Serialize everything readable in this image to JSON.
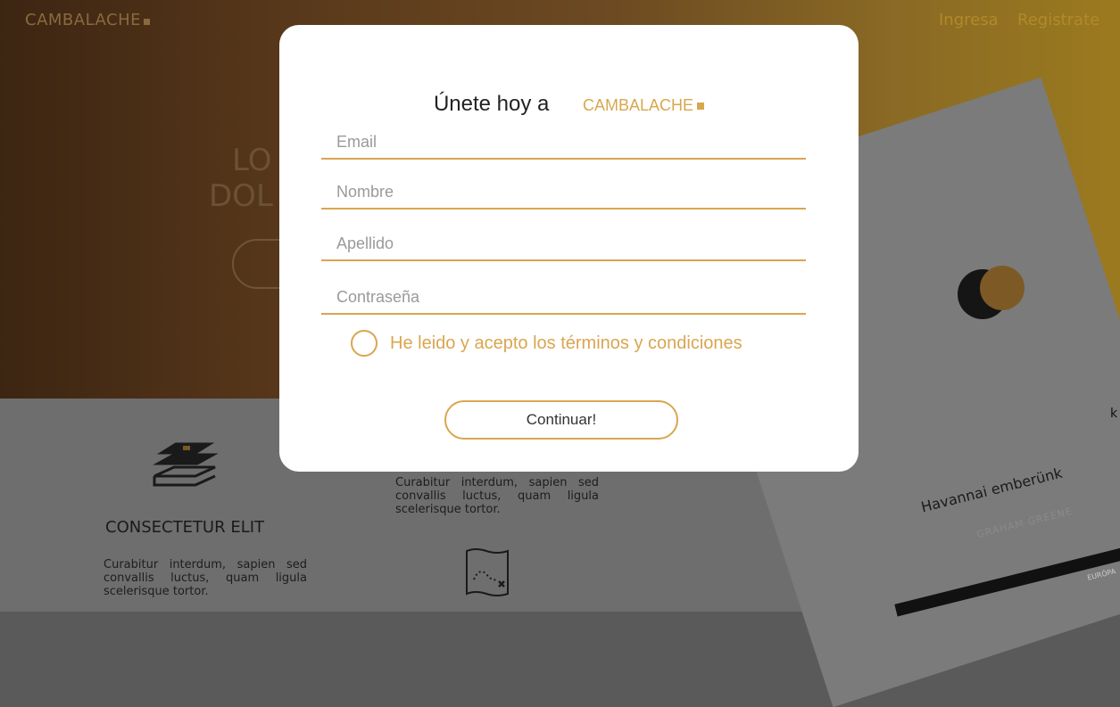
{
  "header": {
    "logo_text": "CAMBALACHE",
    "nav_login": "Ingresa",
    "nav_register": "Registrate"
  },
  "hero": {
    "line1": "LO",
    "line2": "DOL"
  },
  "features": {
    "feature1_title": "CONSECTETUR ELIT",
    "feature1_text": "Curabitur interdum, sapien sed convallis luctus, quam ligula scelerisque tortor.",
    "feature2_text": "Curabitur interdum, sapien sed convallis luctus, quam ligula scelerisque tortor."
  },
  "book": {
    "title": "Havannai emberünk",
    "author": "GRAHAM GREENE",
    "publisher": "EURÓPA",
    "spine_letter": "k"
  },
  "modal": {
    "heading": "Únete hoy a",
    "brand": "CAMBALACHE",
    "email_placeholder": "Email",
    "name_placeholder": "Nombre",
    "surname_placeholder": "Apellido",
    "password_placeholder": "Contraseña",
    "terms_label": "He leido y acepto los términos y condiciones",
    "continue_label": "Continuar!"
  },
  "colors": {
    "accent": "#d9a650",
    "overlay_gold": "#8a6a3e"
  },
  "icons": [
    "books-icon",
    "map-icon",
    "radio-circle-icon"
  ]
}
